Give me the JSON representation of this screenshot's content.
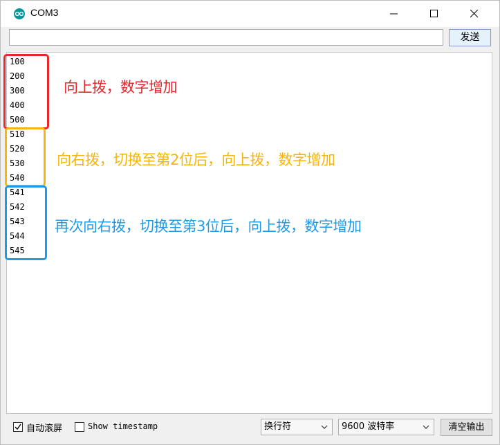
{
  "window": {
    "title": "COM3"
  },
  "send": {
    "input_value": "",
    "button_label": "发送"
  },
  "output": {
    "lines": [
      "100",
      "200",
      "300",
      "400",
      "500",
      "510",
      "520",
      "530",
      "540",
      "541",
      "542",
      "543",
      "544",
      "545"
    ]
  },
  "annotations": [
    {
      "text": "向上拨，数字增加",
      "color": "#e8262b"
    },
    {
      "text": "向右拨，切换至第2位后，向上拨，数字增加",
      "color": "#f5b50a"
    },
    {
      "text": "再次向右拨，切换至第3位后，向上拨，数字增加",
      "color": "#1f9be6"
    }
  ],
  "footer": {
    "autoscroll_label": "自动滚屏",
    "autoscroll_checked": true,
    "timestamp_label": "Show timestamp",
    "timestamp_checked": false,
    "line_ending": "换行符",
    "baud_rate": "9600 波特率",
    "clear_label": "清空输出"
  },
  "colors": {
    "red": "#e8262b",
    "yellow": "#f5b50a",
    "blue": "#1f9be6",
    "app_icon": "#00979c"
  }
}
